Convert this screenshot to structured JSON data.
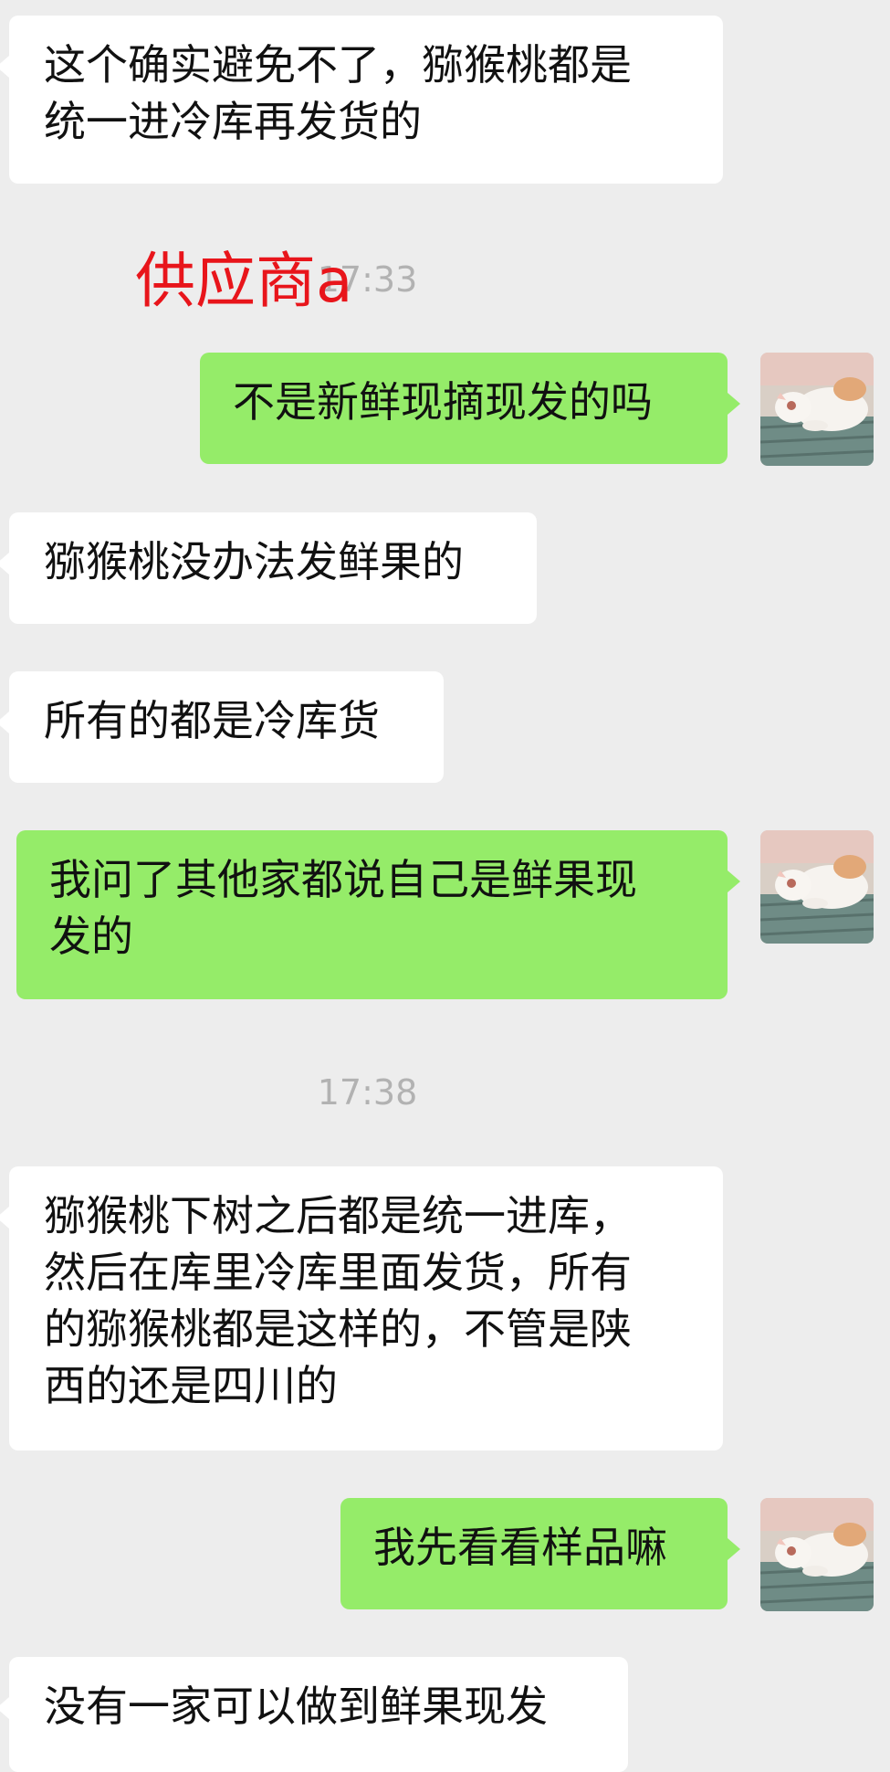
{
  "messages": [
    {
      "id": "m1",
      "side": "received",
      "text": "这个确实避免不了，猕猴桃都是\n统一进冷库再发货的"
    },
    {
      "id": "m2",
      "side": "sent",
      "text": "不是新鲜现摘现发的吗"
    },
    {
      "id": "m3",
      "side": "received",
      "text": "猕猴桃没办法发鲜果的"
    },
    {
      "id": "m4",
      "side": "received",
      "text": "所有的都是冷库货"
    },
    {
      "id": "m5",
      "side": "sent",
      "text": "我问了其他家都说自己是鲜果现\n发的"
    },
    {
      "id": "m6",
      "side": "received",
      "text": "猕猴桃下树之后都是统一进库，\n然后在库里冷库里面发货，所有\n的猕猴桃都是这样的，不管是陕\n西的还是四川的"
    },
    {
      "id": "m7",
      "side": "sent",
      "text": "我先看看样品嘛"
    },
    {
      "id": "m8",
      "side": "received",
      "text": "没有一家可以做到鲜果现发"
    }
  ],
  "timestamps": {
    "t1": "17:33",
    "t2": "17:38"
  },
  "annotation": {
    "text": "供应商a",
    "color": "#e8151b"
  },
  "avatar": {
    "icon": "cat-photo-avatar"
  },
  "colors": {
    "background": "#ededed",
    "sent_bubble": "#95ec69",
    "received_bubble": "#ffffff",
    "timestamp": "#b2b2b2"
  }
}
